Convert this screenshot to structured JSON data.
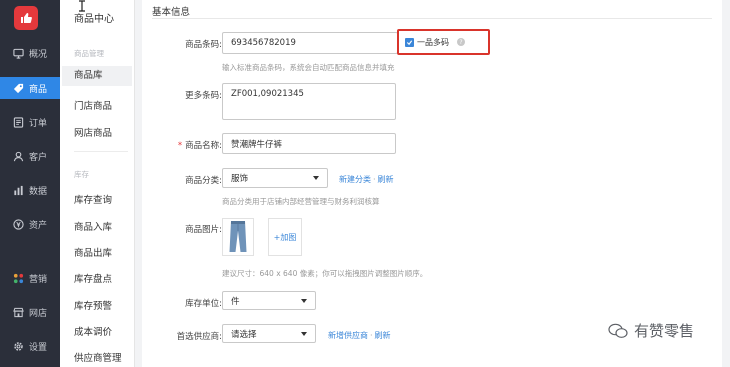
{
  "nav": {
    "items": [
      {
        "label": "概况",
        "icon": "monitor-icon"
      },
      {
        "label": "商品",
        "icon": "tag-icon"
      },
      {
        "label": "订单",
        "icon": "list-icon"
      },
      {
        "label": "客户",
        "icon": "user-icon"
      },
      {
        "label": "数据",
        "icon": "bar-chart-icon"
      },
      {
        "label": "资产",
        "icon": "yen-icon"
      },
      {
        "label": "营销",
        "icon": "grid-icon"
      },
      {
        "label": "网店",
        "icon": "shop-icon"
      },
      {
        "label": "设置",
        "icon": "gear-icon"
      }
    ],
    "active_color": "#2f87e6"
  },
  "sub": {
    "title": "商品中心",
    "section_goods": "商品管理",
    "goods_items": [
      "商品库",
      "门店商品",
      "网店商品"
    ],
    "section_stock": "库存",
    "stock_items": [
      "库存查询",
      "商品入库",
      "商品出库",
      "库存盘点",
      "库存预警",
      "成本调价",
      "供应商管理"
    ]
  },
  "form": {
    "section_title": "基本信息",
    "barcode_label": "商品条码:",
    "barcode_value": "693456782019",
    "multi_code_label": "一品多码",
    "barcode_hint": "输入标准商品条码，系统会自动匹配商品信息并填充",
    "more_codes_label": "更多条码:",
    "more_codes_value": "ZF001,09021345",
    "name_label": "商品名称:",
    "name_value": "赞潮牌牛仔裤",
    "category_label": "商品分类:",
    "category_value": "服饰",
    "category_new": "新建分类",
    "category_refresh": "刷新",
    "category_hint": "商品分类用于店铺内部经营管理与财务利润核算",
    "image_label": "商品图片:",
    "image_add": "+加图",
    "image_hint": "建议尺寸：640 x 640 像素；你可以拖拽图片调整图片顺序。",
    "unit_label": "库存单位:",
    "unit_value": "件",
    "supplier_label": "首选供应商:",
    "supplier_value": "请选择",
    "supplier_new": "新增供应商",
    "supplier_refresh": "刷新"
  },
  "watermark": "有赞零售",
  "colors": {
    "accent": "#3a86d8",
    "highlight_box": "#d9342b",
    "logo": "#e4393c"
  }
}
